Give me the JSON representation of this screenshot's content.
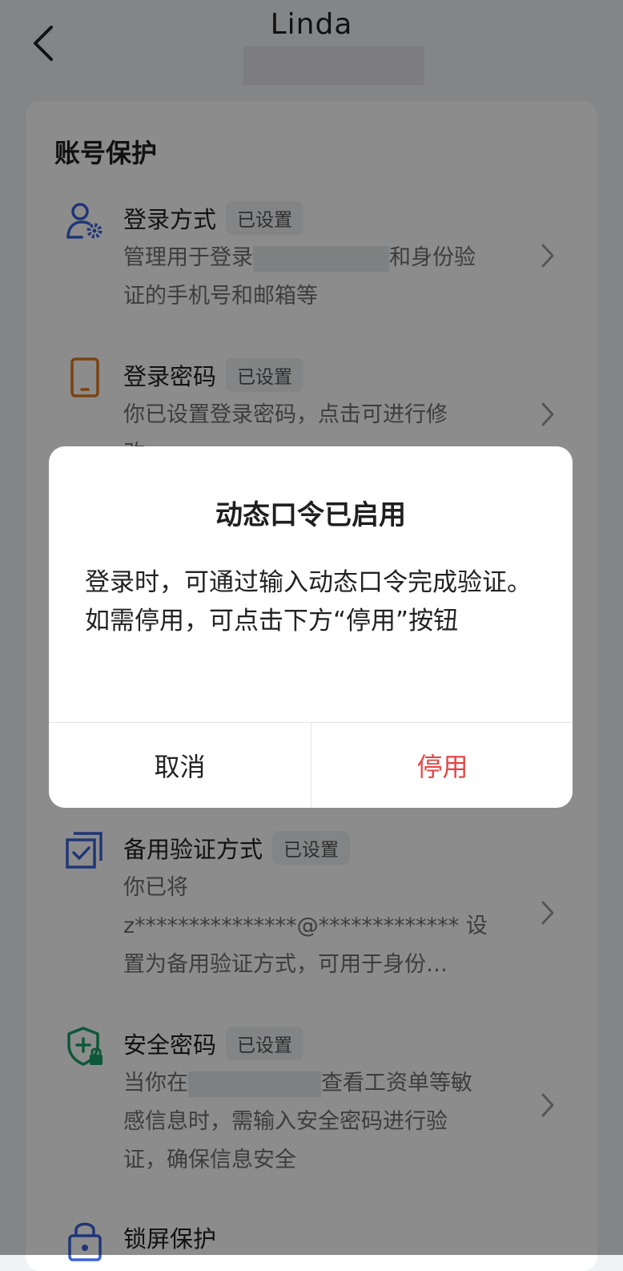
{
  "header": {
    "title": "Linda"
  },
  "section": {
    "title": "账号保护"
  },
  "items": [
    {
      "title": "登录方式",
      "badge": "已设置",
      "desc_a": "管理用于登录",
      "desc_b": "和身份验",
      "desc_c": "证的手机号和邮箱等",
      "icon": "user-gear-icon",
      "icon_color": "#3a63d8"
    },
    {
      "title": "登录密码",
      "badge": "已设置",
      "desc_a": "你已设置登录密码，点击可进行修",
      "desc_b": "改",
      "icon": "phone-icon",
      "icon_color": "#e07a1f"
    },
    {
      "title": "备用验证方式",
      "badge": "已设置",
      "desc_a": "你已将",
      "desc_b": "z***************@************* 设",
      "desc_c": "置为备用验证方式，可用于身份…",
      "icon": "checkbox-stack-icon",
      "icon_color": "#3a63d8"
    },
    {
      "title": "安全密码",
      "badge": "已设置",
      "desc_a": "当你在",
      "desc_b": "查看工资单等敏",
      "desc_c": "感信息时，需输入安全密码进行验",
      "desc_d": "证，确保信息安全",
      "icon": "shield-lock-icon",
      "icon_color": "#1aa06a"
    },
    {
      "title": "锁屏保护",
      "icon": "lock-icon",
      "icon_color": "#3a63d8"
    }
  ],
  "dialog": {
    "title": "动态口令已启用",
    "body": "登录时，可通过输入动态口令完成验证。如需停用，可点击下方“停用”按钮",
    "cancel": "取消",
    "disable": "停用",
    "disable_color": "#e54545"
  }
}
